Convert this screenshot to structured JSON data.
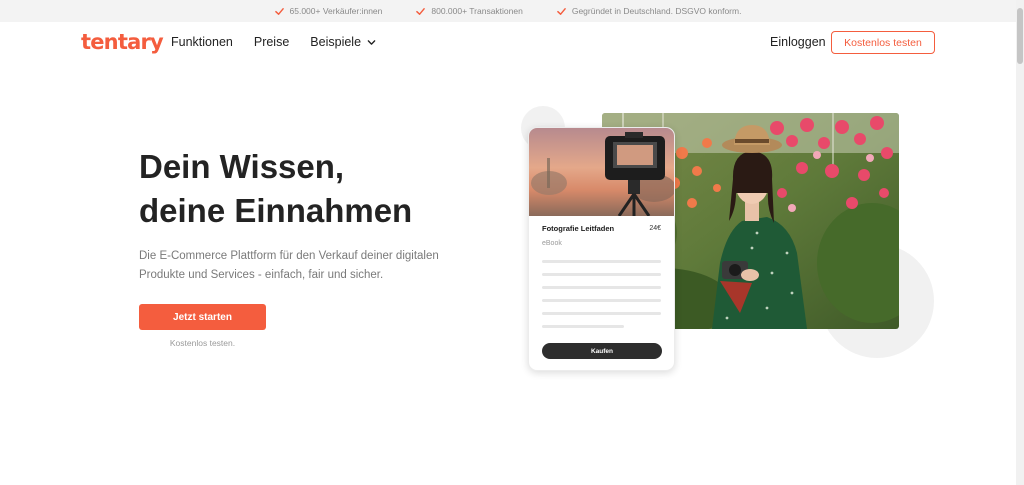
{
  "trust_bar": {
    "items": [
      {
        "text": "65.000+ Verkäufer:innen",
        "icon": "check-icon"
      },
      {
        "text": "800.000+ Transaktionen",
        "icon": "check-icon"
      },
      {
        "text": "Gegründet in Deutschland. DSGVO konform.",
        "icon": "check-icon"
      }
    ],
    "accent_color": "#f45d3e"
  },
  "nav": {
    "logo": "tentary",
    "links": [
      "Funktionen",
      "Preise",
      "Beispiele"
    ],
    "login": "Einloggen",
    "cta": "Kostenlos testen"
  },
  "hero": {
    "title_line1": "Dein Wissen,",
    "title_line2": "deine Einnahmen",
    "subtitle": "Die E-Commerce Plattform für den Verkauf deiner digitalen Produkte und Services - einfach, fair und sicher.",
    "cta": "Jetzt starten",
    "cta_note": "Kostenlos testen."
  },
  "product_card": {
    "title": "Fotografie Leitfaden",
    "price": "24€",
    "type": "eBook",
    "buy_label": "Kaufen"
  },
  "colors": {
    "brand": "#f45d3e",
    "text_dark": "#232323",
    "text_muted": "#7a7a7a",
    "button_dark": "#2e2e2e"
  }
}
